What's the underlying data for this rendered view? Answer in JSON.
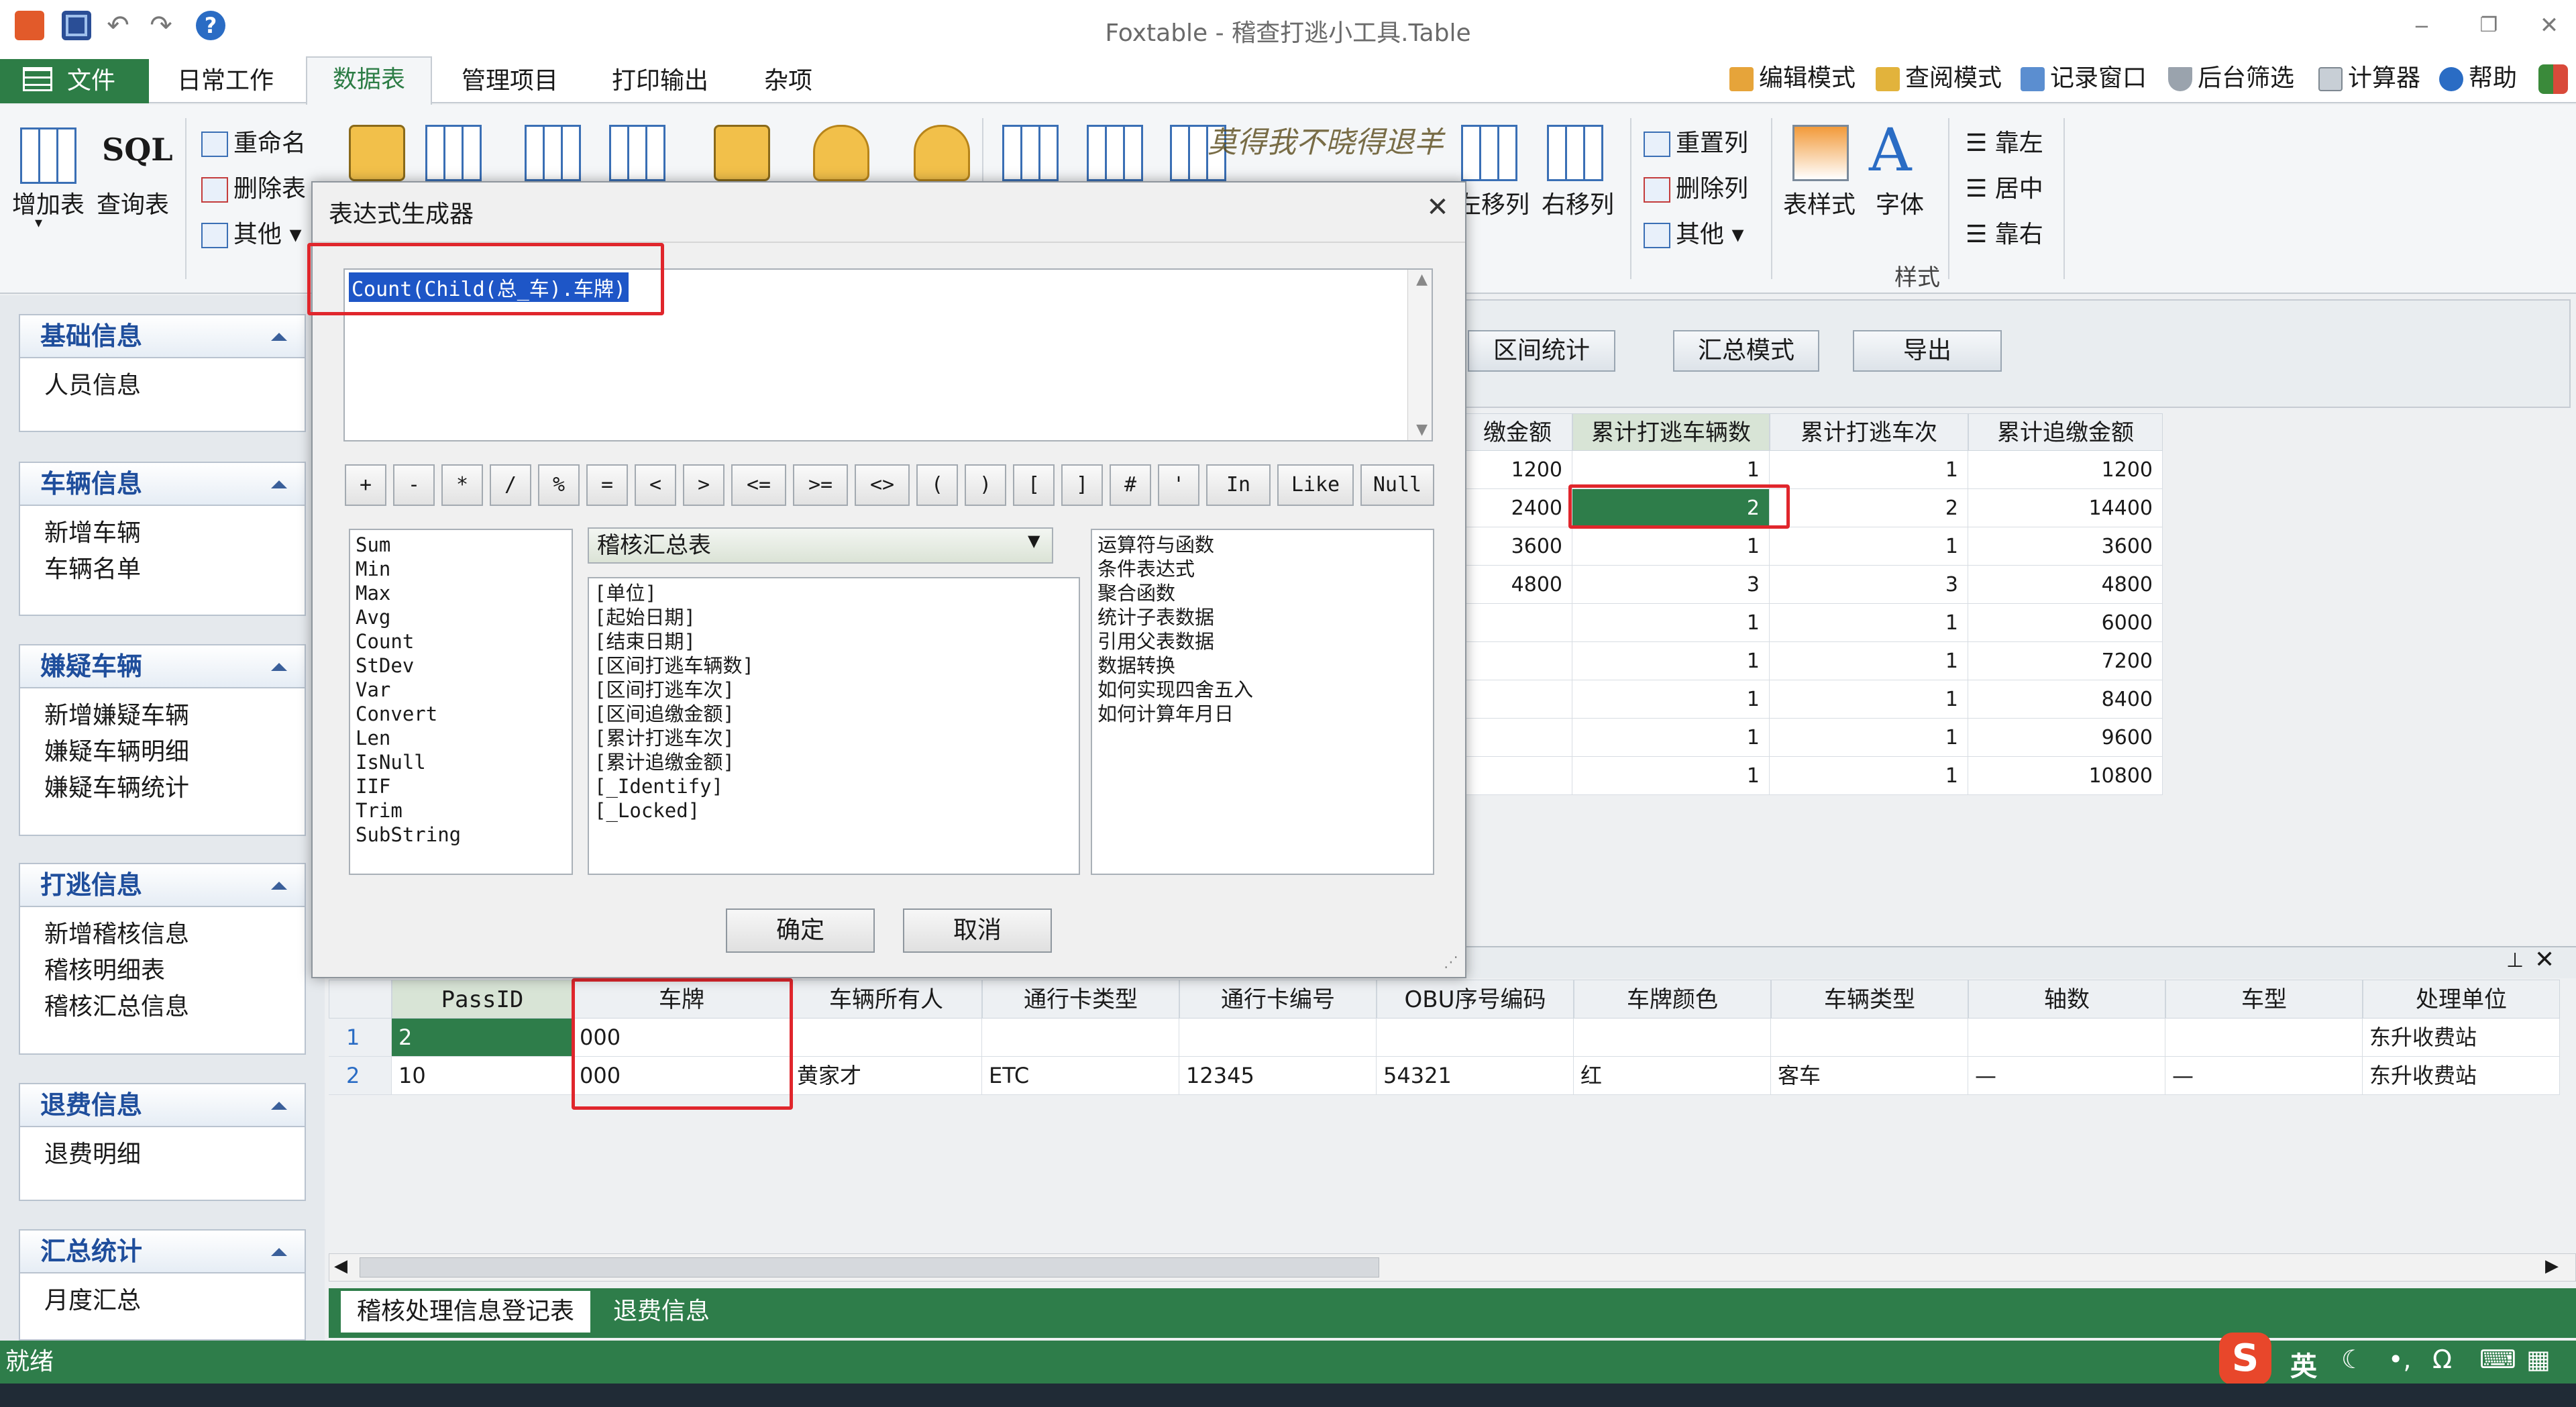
{
  "window": {
    "title": "Foxtable - 稽查打逃小工具.Table"
  },
  "menu": {
    "file": "文件",
    "tabs": [
      "日常工作",
      "数据表",
      "管理项目",
      "打印输出",
      "杂项"
    ],
    "right_links": [
      "编辑模式",
      "查阅模式",
      "记录窗口",
      "后台筛选",
      "计算器",
      "帮助"
    ]
  },
  "ribbon": {
    "add_table": "增加表",
    "query_table": "查询表",
    "sql": "SQL",
    "rename": "重命名",
    "delete_table": "删除表",
    "other1": "其他",
    "move_left": "左移列",
    "move_right": "右移列",
    "reset_col": "重置列",
    "delete_col": "删除列",
    "other2": "其他",
    "table_style": "表样式",
    "font": "字体",
    "align_left": "靠左",
    "align_center": "居中",
    "align_right": "靠右",
    "style_group": "样式",
    "watermark": "莫得我不晓得退羊"
  },
  "sidebar": {
    "groups": [
      {
        "title": "基础信息",
        "items": [
          "人员信息"
        ]
      },
      {
        "title": "车辆信息",
        "items": [
          "新增车辆",
          "车辆名单"
        ]
      },
      {
        "title": "嫌疑车辆",
        "items": [
          "新增嫌疑车辆",
          "嫌疑车辆明细",
          "嫌疑车辆统计"
        ]
      },
      {
        "title": "打逃信息",
        "items": [
          "新增稽核信息",
          "稽核明细表",
          "稽核汇总信息"
        ]
      },
      {
        "title": "退费信息",
        "items": [
          "退费明细"
        ]
      },
      {
        "title": "汇总统计",
        "items": [
          "月度汇总"
        ]
      }
    ]
  },
  "toolbar": {
    "buttons": [
      "区间统计",
      "汇总模式",
      "导出"
    ]
  },
  "upper_table": {
    "columns": [
      "缴金额",
      "累计打逃车辆数",
      "累计打逃车次",
      "累计追缴金额"
    ],
    "rows": [
      [
        "1200",
        "1",
        "1",
        "1200"
      ],
      [
        "2400",
        "2",
        "2",
        "14400"
      ],
      [
        "3600",
        "1",
        "1",
        "3600"
      ],
      [
        "4800",
        "3",
        "3",
        "4800"
      ],
      [
        "",
        "1",
        "1",
        "6000"
      ],
      [
        "",
        "1",
        "1",
        "7200"
      ],
      [
        "",
        "1",
        "1",
        "8400"
      ],
      [
        "",
        "1",
        "1",
        "9600"
      ],
      [
        "",
        "1",
        "1",
        "10800"
      ]
    ]
  },
  "lower_table": {
    "columns": [
      "PassID",
      "车牌",
      "车辆所有人",
      "通行卡类型",
      "通行卡编号",
      "OBU序号编码",
      "车牌颜色",
      "车辆类型",
      "轴数",
      "车型",
      "处理单位"
    ],
    "rows": [
      {
        "num": "1",
        "cells": [
          "2",
          "000",
          "",
          "",
          "",
          "",
          "",
          "",
          "",
          "",
          "东升收费站"
        ]
      },
      {
        "num": "2",
        "cells": [
          "10",
          "000",
          "黄家才",
          "ETC",
          "12345",
          "54321",
          "红",
          "客车",
          "—",
          "—",
          "东升收费站"
        ]
      }
    ]
  },
  "dialog": {
    "title": "表达式生成器",
    "expression": "Count(Child(总_车).车牌)",
    "operators": [
      "+",
      "-",
      "*",
      "/",
      "%",
      "=",
      "<",
      ">",
      "<=",
      ">=",
      "<>",
      "(",
      ")",
      "[",
      "]",
      "#",
      "'",
      "In",
      "Like",
      "Null"
    ],
    "functions": [
      "Sum",
      "Min",
      "Max",
      "Avg",
      "Count",
      "StDev",
      "Var",
      "Convert",
      "Len",
      "IsNull",
      "IIF",
      "Trim",
      "SubString"
    ],
    "table_select": "稽核汇总表",
    "fields": [
      "[单位]",
      "[起始日期]",
      "[结束日期]",
      "[区间打逃车辆数]",
      "[区间打逃车次]",
      "[区间追缴金额]",
      "[累计打逃车次]",
      "[累计追缴金额]",
      "[_Identify]",
      "[_Locked]"
    ],
    "help_topics": [
      "运算符与函数",
      "条件表达式",
      "聚合函数",
      "统计子表数据",
      "引用父表数据",
      "数据转换",
      "如何实现四舍五入",
      "如何计算年月日"
    ],
    "ok": "确定",
    "cancel": "取消"
  },
  "sheet_tabs": [
    "稽核处理信息登记表",
    "退费信息"
  ],
  "status": {
    "text": "就绪",
    "ime": "英"
  },
  "colors": {
    "accent_green": "#2d7d46",
    "highlight_red": "#e0262c",
    "selection_blue": "#1e56c7"
  }
}
